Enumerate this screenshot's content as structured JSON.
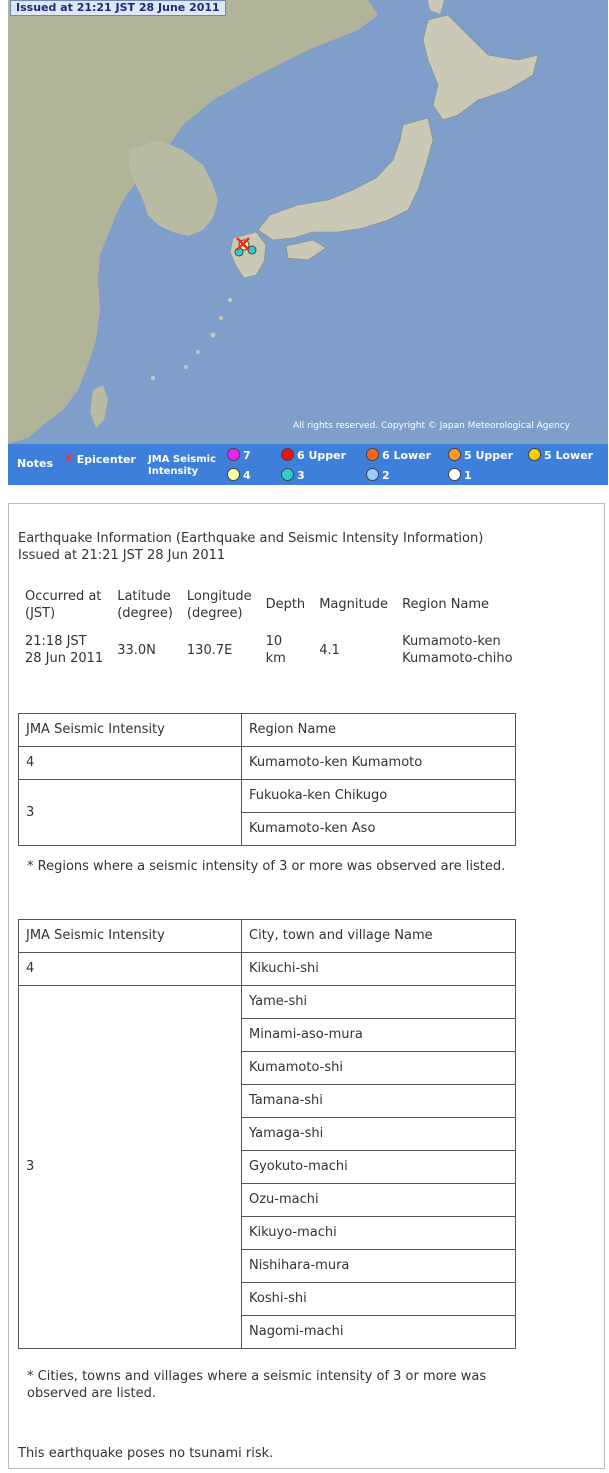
{
  "map": {
    "issued_label": "Issued at 21:21 JST  28 June 2011",
    "copyright": "All rights reserved. Copyright © Japan Meteorological Agency",
    "colors": {
      "sea": "#7f9fca",
      "land_mainland": "#c9c9b6",
      "land_continent": "#b2b49a"
    }
  },
  "legend": {
    "notes": "Notes",
    "epicenter": "Epicenter",
    "jma_line1": "JMA Seismic",
    "jma_line2": "Intensity",
    "items": [
      {
        "label": "7",
        "color": "#ee22ee"
      },
      {
        "label": "6 Upper",
        "color": "#ee1111"
      },
      {
        "label": "6 Lower",
        "color": "#ff6611"
      },
      {
        "label": "5 Upper",
        "color": "#ff9922"
      },
      {
        "label": "5 Lower",
        "color": "#ffcc00"
      },
      {
        "label": "4",
        "color": "#ffffaa"
      },
      {
        "label": "3",
        "color": "#33cccc"
      },
      {
        "label": "2",
        "color": "#99ccff"
      },
      {
        "label": "1",
        "color": "#ffffff"
      }
    ]
  },
  "info": {
    "title": "Earthquake Information (Earthquake and Seismic Intensity Information)",
    "issued": "Issued at 21:21 JST 28 Jun 2011",
    "quake_headers": {
      "occurred_1": "Occurred at",
      "occurred_2": "(JST)",
      "lat_1": "Latitude",
      "lat_2": "(degree)",
      "lon_1": "Longitude",
      "lon_2": "(degree)",
      "depth": "Depth",
      "magnitude": "Magnitude",
      "region": "Region Name"
    },
    "quake": {
      "time_1": "21:18 JST",
      "time_2": "28 Jun 2011",
      "lat": "33.0N",
      "lon": "130.7E",
      "depth_1": "10",
      "depth_2": "km",
      "magnitude": "4.1",
      "region_1": "Kumamoto-ken",
      "region_2": "Kumamoto-chiho"
    },
    "region_table": {
      "h1": "JMA Seismic Intensity",
      "h2": "Region Name",
      "r1_int": "4",
      "r1_name": "Kumamoto-ken Kumamoto",
      "r2_int": "3",
      "r2_name": "Fukuoka-ken Chikugo",
      "r3_name": "Kumamoto-ken Aso"
    },
    "region_note": "* Regions where a seismic intensity of 3 or more was observed are listed.",
    "city_table": {
      "h1": "JMA Seismic Intensity",
      "h2": "City, town and village Name",
      "int4": "4",
      "int4_city": "Kikuchi-shi",
      "int3": "3",
      "int3_cities": [
        "Yame-shi",
        "Minami-aso-mura",
        "Kumamoto-shi",
        "Tamana-shi",
        "Yamaga-shi",
        "Gyokuto-machi",
        "Ozu-machi",
        "Kikuyo-machi",
        "Nishihara-mura",
        "Koshi-shi",
        "Nagomi-machi"
      ]
    },
    "city_note_1": "* Cities, towns and villages where a seismic intensity of 3 or more was",
    "city_note_2": "observed are listed.",
    "tsunami": "This earthquake poses no tsunami risk."
  }
}
